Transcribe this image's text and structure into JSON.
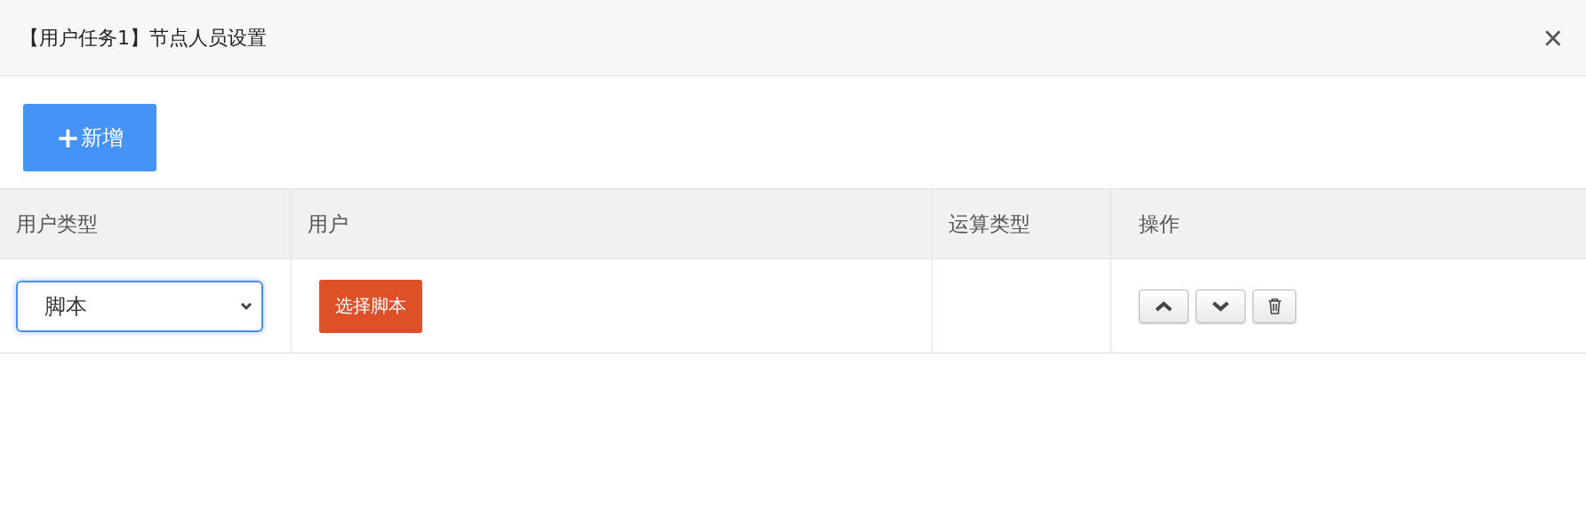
{
  "dialog": {
    "title": "【用户任务1】节点人员设置",
    "close_glyph": "×"
  },
  "toolbar": {
    "add_button": {
      "icon": "+",
      "label": "新增"
    }
  },
  "table": {
    "columns": [
      "用户类型",
      "用户",
      "运算类型",
      "操作"
    ],
    "rows": [
      {
        "user_type": {
          "value": "脚本",
          "focused": true
        },
        "user": {
          "button": "选择脚本"
        },
        "actions": [
          {
            "kind": "up"
          },
          {
            "kind": "down"
          },
          {
            "kind": "delete"
          }
        ]
      }
    ]
  }
}
